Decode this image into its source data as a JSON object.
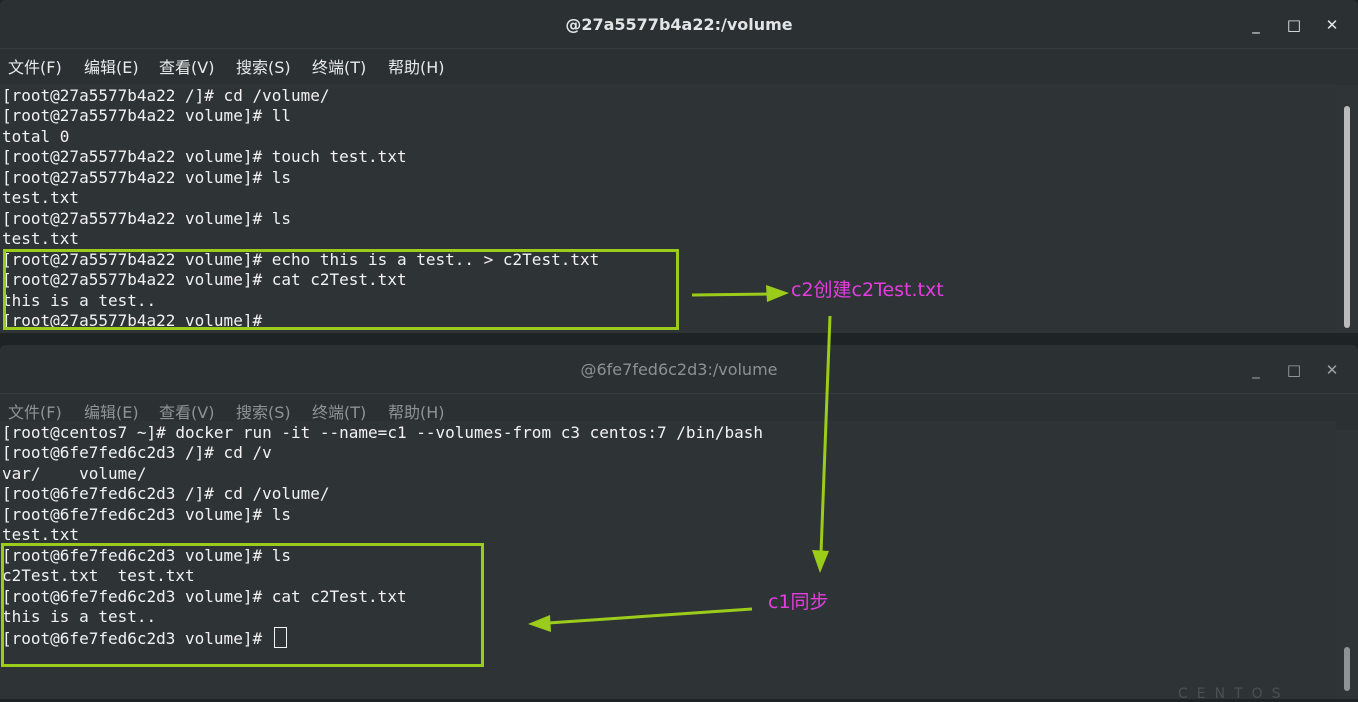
{
  "window1": {
    "title": "@27a5577b4a22:/volume",
    "menu": [
      "文件(F)",
      "编辑(E)",
      "查看(V)",
      "搜索(S)",
      "终端(T)",
      "帮助(H)"
    ],
    "lines": [
      "[root@27a5577b4a22 /]# cd /volume/",
      "[root@27a5577b4a22 volume]# ll",
      "total 0",
      "[root@27a5577b4a22 volume]# touch test.txt",
      "[root@27a5577b4a22 volume]# ls",
      "test.txt",
      "[root@27a5577b4a22 volume]# ls",
      "test.txt",
      "[root@27a5577b4a22 volume]# echo this is a test.. > c2Test.txt",
      "[root@27a5577b4a22 volume]# cat c2Test.txt",
      "this is a test..",
      "[root@27a5577b4a22 volume]#"
    ]
  },
  "window2": {
    "title": "@6fe7fed6c2d3:/volume",
    "menu": [
      "文件(F)",
      "编辑(E)",
      "查看(V)",
      "搜索(S)",
      "终端(T)",
      "帮助(H)"
    ],
    "lines": [
      "[root@centos7 ~]# docker run -it --name=c1 --volumes-from c3 centos:7 /bin/bash",
      "[root@6fe7fed6c2d3 /]# cd /v",
      "var/    volume/",
      "[root@6fe7fed6c2d3 /]# cd /volume/",
      "[root@6fe7fed6c2d3 volume]# ls",
      "test.txt",
      "[root@6fe7fed6c2d3 volume]# ls",
      "c2Test.txt  test.txt",
      "[root@6fe7fed6c2d3 volume]# cat c2Test.txt",
      "this is a test..",
      "[root@6fe7fed6c2d3 volume]# "
    ]
  },
  "window_buttons": {
    "minimize": "_",
    "maximize": "□",
    "close": "✕"
  },
  "annotations": {
    "note1": "c2创建c2Test.txt",
    "note2": "c1同步"
  },
  "desktop_watermark": "CENTOS",
  "colors": {
    "highlight_box": "#9ccc1a",
    "arrow": "#9ccc1a",
    "note_text": "#e43de0",
    "terminal_bg": "#2e3436",
    "terminal_fg": "#f2f2f2"
  }
}
